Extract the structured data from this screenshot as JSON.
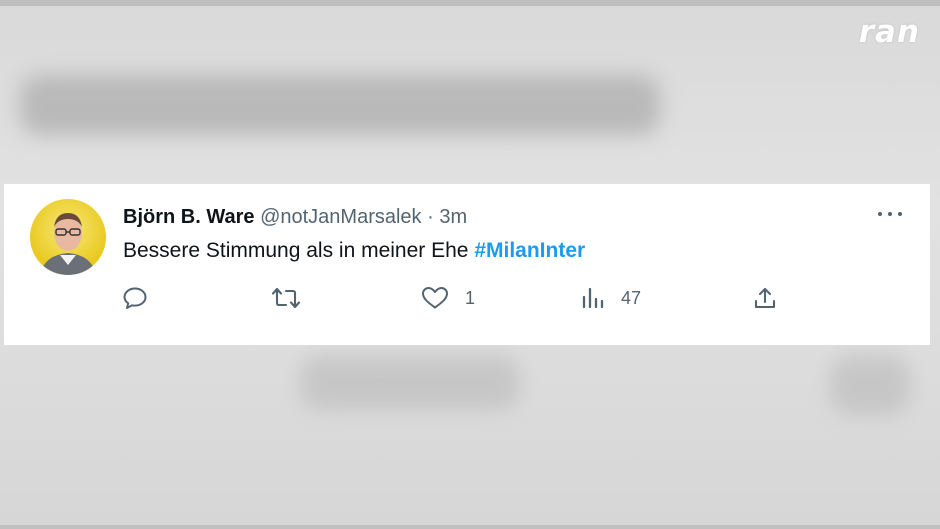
{
  "brand": {
    "logo": "ran"
  },
  "tweet": {
    "author_name": "Björn B. Ware",
    "handle": "@notJanMarsalek",
    "separator": "·",
    "time": "3m",
    "text": "Bessere Stimmung als in meiner Ehe ",
    "hashtag": "#MilanInter",
    "actions": {
      "reply": {
        "icon": "reply-icon",
        "count": ""
      },
      "retweet": {
        "icon": "retweet-icon",
        "count": ""
      },
      "like": {
        "icon": "heart-icon",
        "count": "1"
      },
      "views": {
        "icon": "views-icon",
        "count": "47"
      },
      "share": {
        "icon": "share-icon",
        "count": ""
      }
    },
    "more_icon": "more-horizontal-icon"
  },
  "colors": {
    "hashtag": "#1d9bf0",
    "text": "#0f1419",
    "muted": "#536471",
    "avatar_bg": "#e9c91d"
  }
}
